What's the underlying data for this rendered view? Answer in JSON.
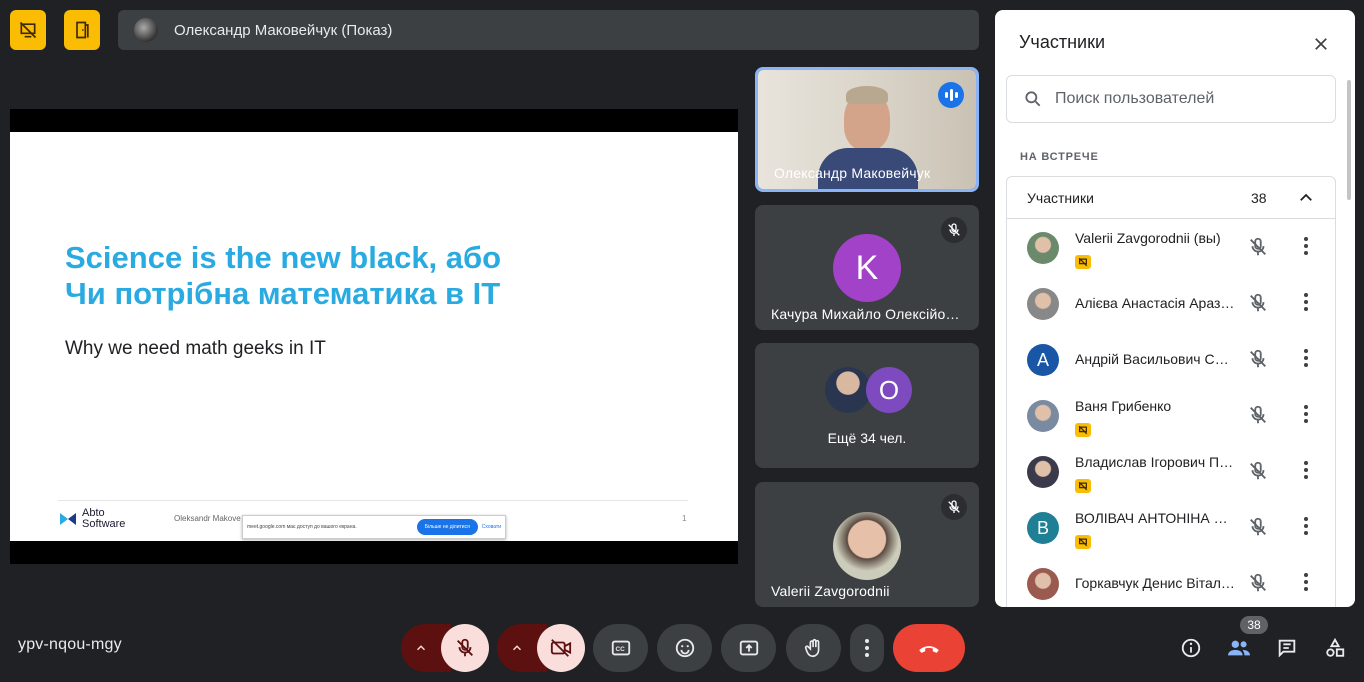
{
  "top": {
    "presenter_label": "Олександр Маковейчук (Показ)"
  },
  "slide": {
    "title_line1": "Science is the new black, або",
    "title_line2": "Чи потрібна математика в IT",
    "subtitle": "Why we need math geeks in IT",
    "logo_line1": "Abto",
    "logo_line2": "Software",
    "author": "Oleksandr Makove",
    "page": "1",
    "toast_text": "meet.google.com має доступ до вашого екрана.",
    "toast_stop": "Більше не ділитися",
    "toast_hide": "Сховати"
  },
  "tiles": [
    {
      "name": "Олександр Маковейчук"
    },
    {
      "name": "Качура Михайло Олексійович",
      "initial": "K"
    },
    {
      "name": "Ещё 34 чел.",
      "initial": "O"
    },
    {
      "name": "Valerii Zavgorodnii"
    }
  ],
  "panel": {
    "title": "Участники",
    "search_placeholder": "Поиск пользователей",
    "section": "НА ВСТРЕЧЕ",
    "group_label": "Участники",
    "group_count": "38",
    "participants": [
      {
        "name": "Valerii Zavgorodnii (вы)",
        "badge": true
      },
      {
        "name": "Алієва Анастасія Аразівна",
        "badge": false
      },
      {
        "name": "Андрій Васильович Савченко",
        "initial": "А",
        "color": "#1a56a6",
        "badge": false
      },
      {
        "name": "Ваня Грибенко",
        "badge": true
      },
      {
        "name": "Владислав Ігорович Петренко",
        "badge": true
      },
      {
        "name": "ВОЛІВАЧ АНТОНІНА Петрівна",
        "initial": "В",
        "color": "#1e7f95",
        "badge": true
      },
      {
        "name": "Горкавчук Денис Віталійович",
        "badge": false
      }
    ]
  },
  "bottom": {
    "meeting_code": "ypv-nqou-mgy",
    "people_count": "38"
  },
  "colors": {
    "background": "#202124",
    "accent_yellow": "#fbbc04",
    "hangup_red": "#ea4335",
    "speaking_blue": "#1a73e8"
  }
}
